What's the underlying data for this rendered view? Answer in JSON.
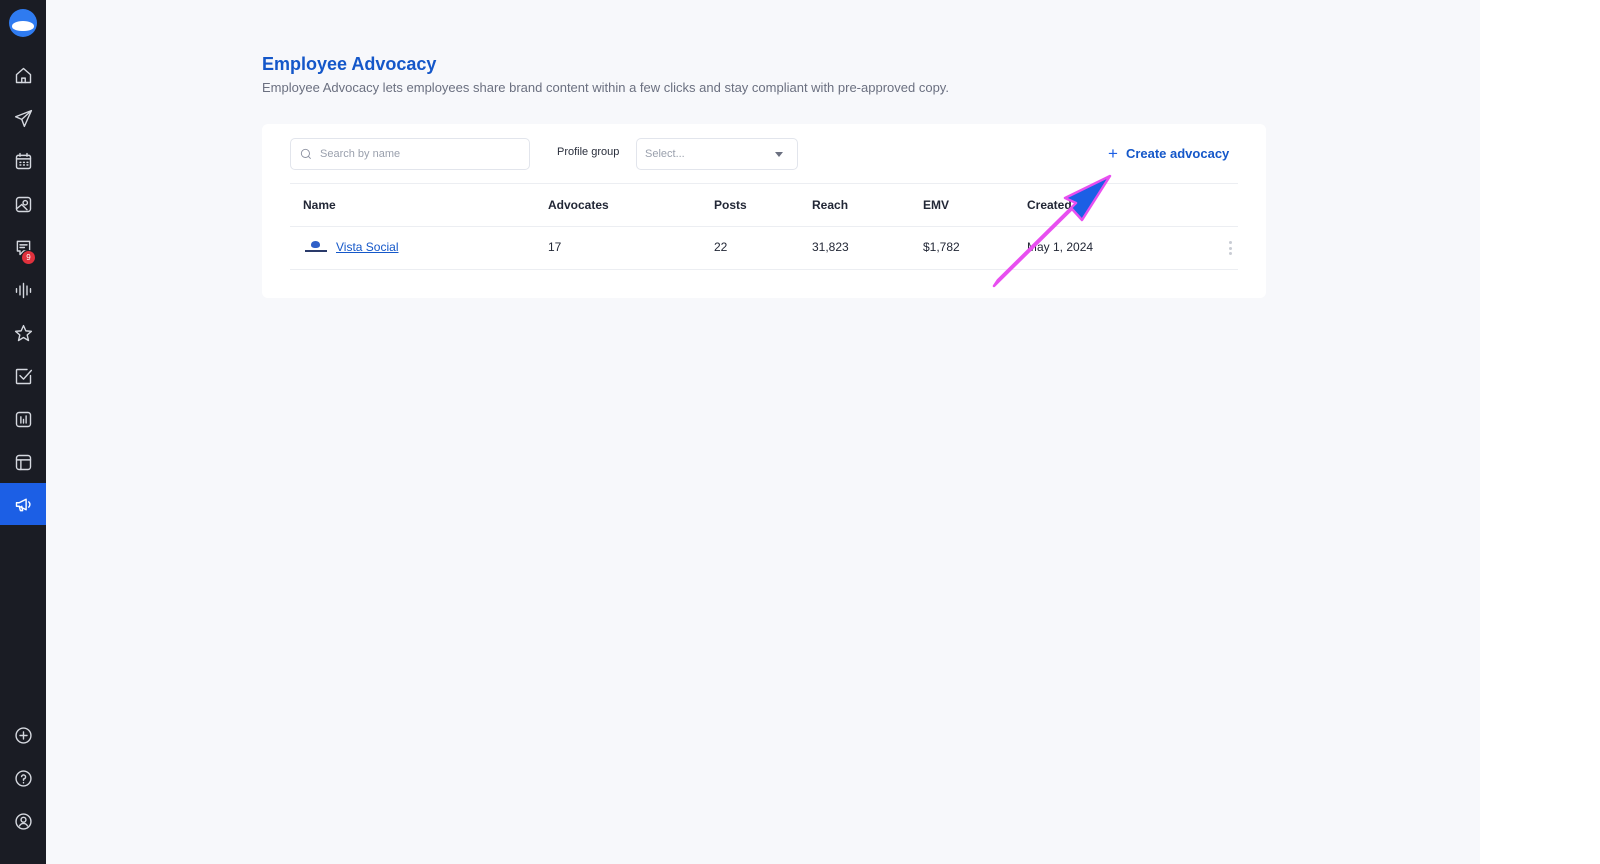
{
  "sidebar": {
    "logo": "vista-social-logo",
    "items": [
      {
        "icon": "home-icon",
        "active": false
      },
      {
        "icon": "send-icon",
        "active": false
      },
      {
        "icon": "calendar-icon",
        "active": false
      },
      {
        "icon": "media-icon",
        "active": false
      },
      {
        "icon": "inbox-icon",
        "active": false,
        "badge": "9"
      },
      {
        "icon": "listening-icon",
        "active": false
      },
      {
        "icon": "star-icon",
        "active": false
      },
      {
        "icon": "tasks-icon",
        "active": false
      },
      {
        "icon": "reports-icon",
        "active": false
      },
      {
        "icon": "layout-icon",
        "active": false
      },
      {
        "icon": "megaphone-icon",
        "active": true
      }
    ],
    "bottom_items": [
      {
        "icon": "add-circle-icon"
      },
      {
        "icon": "help-icon"
      },
      {
        "icon": "profile-icon"
      }
    ],
    "badge_color": "#e0313d",
    "active_color": "#1c5fe5"
  },
  "header": {
    "title": "Employee Advocacy",
    "description": "Employee Advocacy lets employees share brand content within a few clicks and stay compliant with pre-approved copy."
  },
  "toolbar": {
    "search_placeholder": "Search by name",
    "search_value": "",
    "profile_group_label": "Profile group",
    "profile_group_placeholder": "Select...",
    "create_label": "Create advocacy"
  },
  "table": {
    "columns": [
      "Name",
      "Advocates",
      "Posts",
      "Reach",
      "EMV",
      "Created"
    ],
    "rows": [
      {
        "name": "Vista Social",
        "advocates": "17",
        "posts": "22",
        "reach": "31,823",
        "emv": "$1,782",
        "created": "May 1, 2024"
      }
    ]
  },
  "annotation": {
    "arrow_color": "#1c5fe5",
    "arrow_outline_color": "#e84ff0"
  },
  "colors": {
    "accent": "#1457c9",
    "sidebar_bg": "#1a1c24",
    "page_bg": "#f7f8fb"
  }
}
